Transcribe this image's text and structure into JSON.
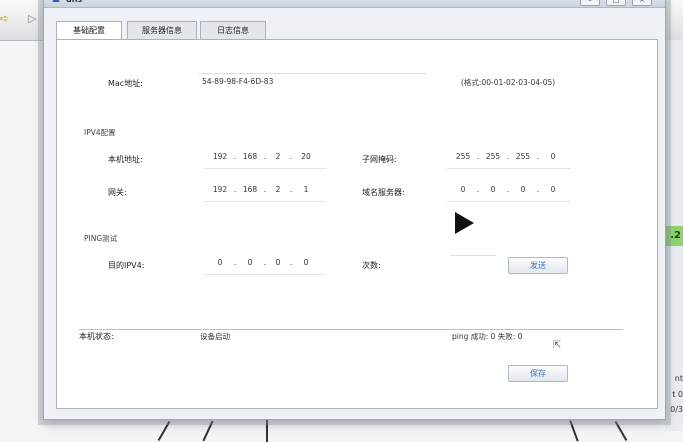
{
  "window": {
    "title": "dns"
  },
  "tabs": [
    {
      "label": "基础配置",
      "active": true
    },
    {
      "label": "服务器信息",
      "active": false
    },
    {
      "label": "日志信息",
      "active": false
    }
  ],
  "mac": {
    "label": "Mac地址:",
    "value": "54-89-98-F4-6D-83",
    "format_hint": "(格式:00-01-02-03-04-05)"
  },
  "ipv4": {
    "section_title": "IPV4配置",
    "local_ip": {
      "label": "本机地址:",
      "octets": [
        "192",
        "168",
        "2",
        "20"
      ]
    },
    "subnet": {
      "label": "子网掩码:",
      "octets": [
        "255",
        "255",
        "255",
        "0"
      ]
    },
    "gateway": {
      "label": "网关:",
      "octets": [
        "192",
        "168",
        "2",
        "1"
      ]
    },
    "dns": {
      "label": "域名服务器:",
      "octets": [
        "0",
        "0",
        "0",
        "0"
      ]
    }
  },
  "ping": {
    "section_title": "PING测试",
    "target": {
      "label": "目的IPV4:",
      "octets": [
        "0",
        "0",
        "0",
        "0"
      ]
    },
    "count": {
      "label": "次数:",
      "value": ""
    },
    "send_label": "发送"
  },
  "status": {
    "label": "本机状态:",
    "value": "设备启动",
    "ping_result": "ping 成功: 0 失败: 0"
  },
  "save_label": "保存",
  "background": {
    "edge_label": ".2",
    "edge_lines": [
      "nt",
      "t 0",
      "0/3"
    ]
  },
  "colors": {
    "accent": "#3a6fb0",
    "panel": "#ffffff",
    "window": "#eef1f5",
    "status_green": "#8fd36f"
  }
}
